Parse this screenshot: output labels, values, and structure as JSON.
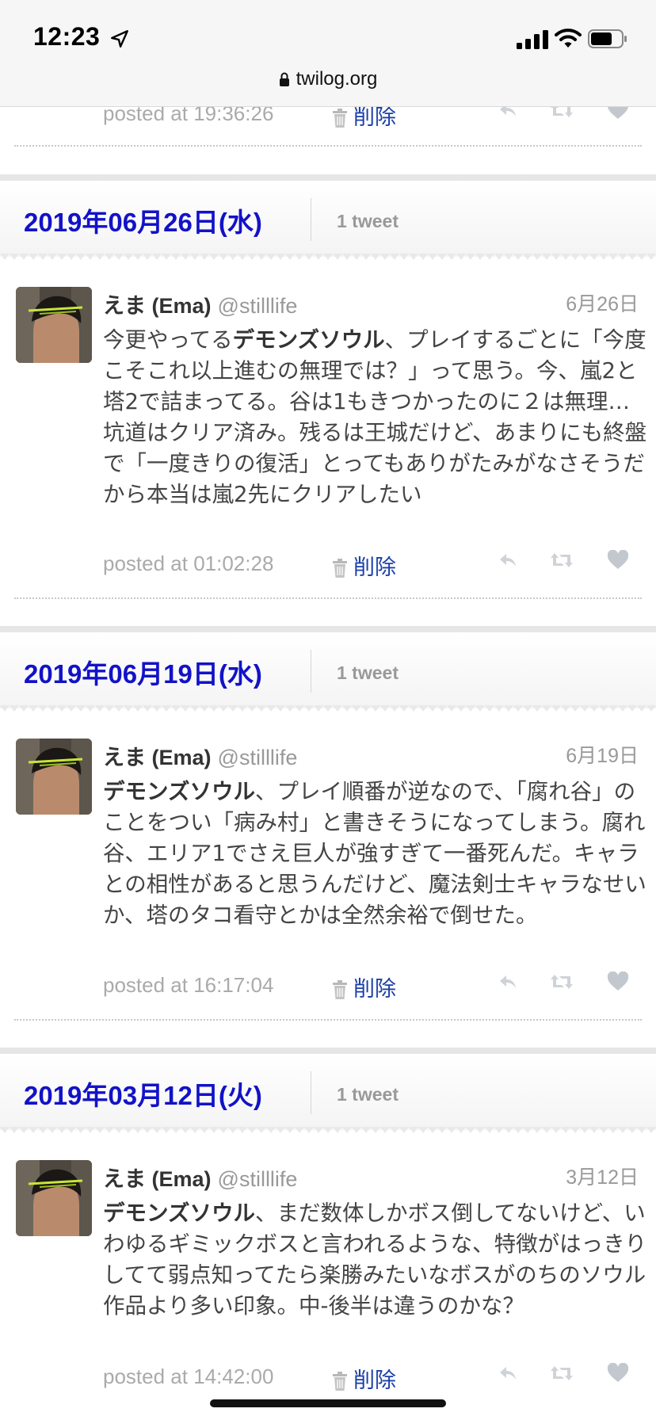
{
  "status_bar": {
    "time": "12:23"
  },
  "browser": {
    "domain": "twilog.org"
  },
  "top_partial": {
    "posted": "posted at 19:36:26",
    "delete_label": "削除"
  },
  "days": [
    {
      "date": "2019年06月26日(水)",
      "count": "1 tweet",
      "tweet": {
        "name": "えま (Ema)",
        "handle": "@stilllife",
        "date": "6月26日",
        "bold": "デモンズソウル",
        "text_pre": "今更やってる",
        "text_post": "、プレイするごとに「今度こそこれ以上進むの無理では？」って思う。今、嵐2と塔2で詰まってる。谷は1もきつかったのに２は無理…坑道はクリア済み。残るは王城だけど、あまりにも終盤で「一度きりの復活」とってもありがたみがなさそうだから本当は嵐2先にクリアしたい",
        "posted": "posted at 01:02:28",
        "delete_label": "削除"
      }
    },
    {
      "date": "2019年06月19日(水)",
      "count": "1 tweet",
      "tweet": {
        "name": "えま (Ema)",
        "handle": "@stilllife",
        "date": "6月19日",
        "bold": "デモンズソウル",
        "text_pre": "",
        "text_post": "、プレイ順番が逆なので、「腐れ谷」のことをつい「病み村」と書きそうになってしまう。腐れ谷、エリア1でさえ巨人が強すぎて一番死んだ。キャラとの相性があると思うんだけど、魔法剣士キャラなせいか、塔のタコ看守とかは全然余裕で倒せた。",
        "posted": "posted at 16:17:04",
        "delete_label": "削除"
      }
    },
    {
      "date": "2019年03月12日(火)",
      "count": "1 tweet",
      "tweet": {
        "name": "えま (Ema)",
        "handle": "@stilllife",
        "date": "3月12日",
        "bold": "デモンズソウル",
        "text_pre": "",
        "text_post": "、まだ数体しかボス倒してないけど、いわゆるギミックボスと言われるような、特徴がはっきりしてて弱点知ってたら楽勝みたいなボスがのちのソウル作品より多い印象。中-後半は違うのかな？",
        "posted": "posted at 14:42:00",
        "delete_label": "削除"
      }
    }
  ],
  "icons": [
    "location-arrow-icon",
    "signal-icon",
    "wifi-icon",
    "battery-icon",
    "lock-icon",
    "trash-icon",
    "reply-icon",
    "retweet-icon",
    "heart-icon"
  ],
  "colors": {
    "date_link": "#1212c8",
    "delete_link": "#1a3fa8",
    "muted": "#999999"
  }
}
